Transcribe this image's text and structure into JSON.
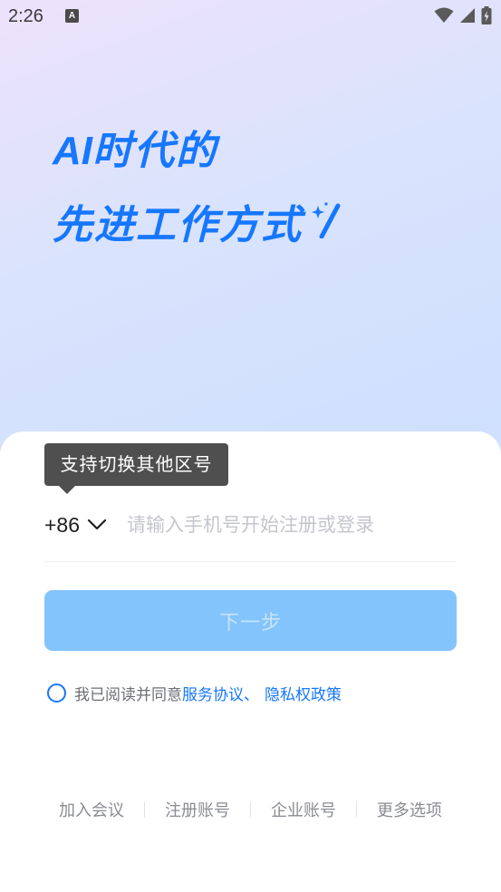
{
  "status_bar": {
    "time": "2:26",
    "notification_icon": "a-text-icon",
    "wifi_icon": "wifi-icon",
    "signal_icon": "cellular-signal-icon",
    "battery_icon": "battery-charging-icon"
  },
  "hero": {
    "line1_ai": "AI",
    "line1_rest": "时代的",
    "line2": "先进工作方式",
    "sparkle_icon": "sparkle-slash-icon",
    "color": "#1677ff"
  },
  "login": {
    "tooltip": "支持切换其他区号",
    "country_code": "+86",
    "phone_placeholder": "请输入手机号开始注册或登录",
    "next_button": "下一步",
    "agreement": {
      "prefix": "我已阅读并同意",
      "service_link": "服务协议",
      "separator": "、",
      "privacy_link": "隐私权政策"
    }
  },
  "footer": {
    "links": [
      "加入会议",
      "注册账号",
      "企业账号",
      "更多选项"
    ]
  },
  "colors": {
    "accent": "#1677ff",
    "button_disabled": "#83c4fc",
    "tooltip_bg": "#4f4f4f"
  }
}
